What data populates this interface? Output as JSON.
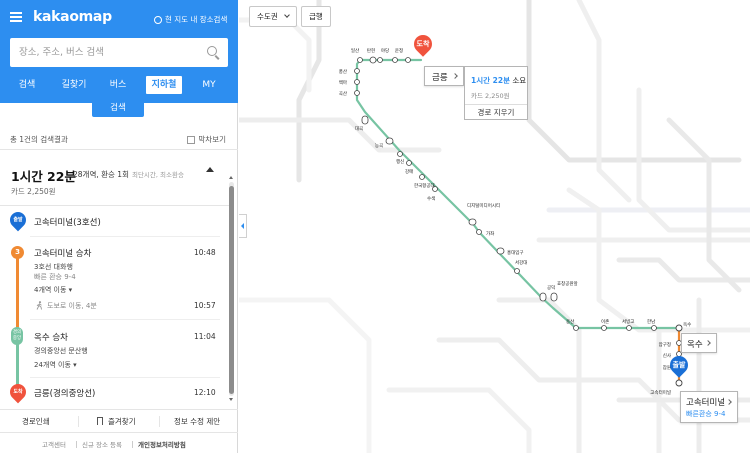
{
  "header": {
    "logo": "kakaomap",
    "nearby_search": "현 지도 내 장소검색",
    "search_placeholder": "장소, 주소, 버스 검색",
    "tabs": [
      {
        "label": "검색"
      },
      {
        "label": "길찾기"
      },
      {
        "label": "버스"
      },
      {
        "label": "지하철",
        "active": true
      },
      {
        "label": "MY"
      }
    ],
    "search_button": "검색",
    "accent_color": "#2d8ef0"
  },
  "results": {
    "count_text": "총 1건의 검색결과",
    "subway_view_label": "막차보기"
  },
  "route": {
    "total_time": "1시간 22분",
    "info": "28개역, 환승 1회",
    "criteria": "최단시간, 최소환승",
    "fare": "카드 2,250원"
  },
  "steps": {
    "start_badge": "출발",
    "start_station": "고속터미널(3호선)",
    "line3_badge": "3",
    "board1_title": "고속터미널 승차",
    "board1_time": "10:48",
    "board1_line": "3호선 대화행",
    "board1_transfer": "빠른 환승 9-4",
    "board1_stops": "4개역 이동",
    "walk_text": "도보로 이동, 4분",
    "walk_time": "10:57",
    "line2_badge": "경의중앙",
    "board2_title": "옥수 승차",
    "board2_time": "11:04",
    "board2_line": "경의중앙선 문산행",
    "board2_stops": "24개역 이동",
    "end_badge": "도착",
    "end_station": "금릉(경의중앙선)",
    "end_time": "12:10",
    "line3_color": "#f08a33",
    "line2_color": "#77c4a3",
    "start_color": "#1a6fd6",
    "end_color": "#f0533d"
  },
  "actions": {
    "print": "경로인쇄",
    "favorite": "즐겨찾기",
    "suggest": "정보 수정 제안"
  },
  "footer": {
    "service_center": "고객센터",
    "new_place": "신규 장소 등록",
    "privacy": "개인정보처리방침"
  },
  "map": {
    "region_select": "수도권",
    "last_train": "급행",
    "dest_callout": "금릉",
    "info_time_prefix": "1시간 22분",
    "info_time_suffix": "소요",
    "info_fare": "카드 2,250원",
    "info_clear": "경로 지우기",
    "transfer_callout": "옥수",
    "origin_callout": "고속터미널",
    "origin_sub": "빠른환승 9-4",
    "dest_pin": "도착",
    "origin_pin": "출발",
    "station_labels": [
      "일산",
      "탄현",
      "야당",
      "운정",
      "풍산",
      "백마",
      "곡산",
      "대곡",
      "능곡",
      "행신",
      "강매",
      "한국항공대",
      "수색",
      "디지털미디어시티",
      "가좌",
      "홍대입구",
      "서강대",
      "공덕",
      "효창공원앞",
      "용산",
      "이촌",
      "서빙고",
      "한남",
      "옥수",
      "압구정",
      "신사",
      "잠원",
      "고속터미널"
    ]
  }
}
